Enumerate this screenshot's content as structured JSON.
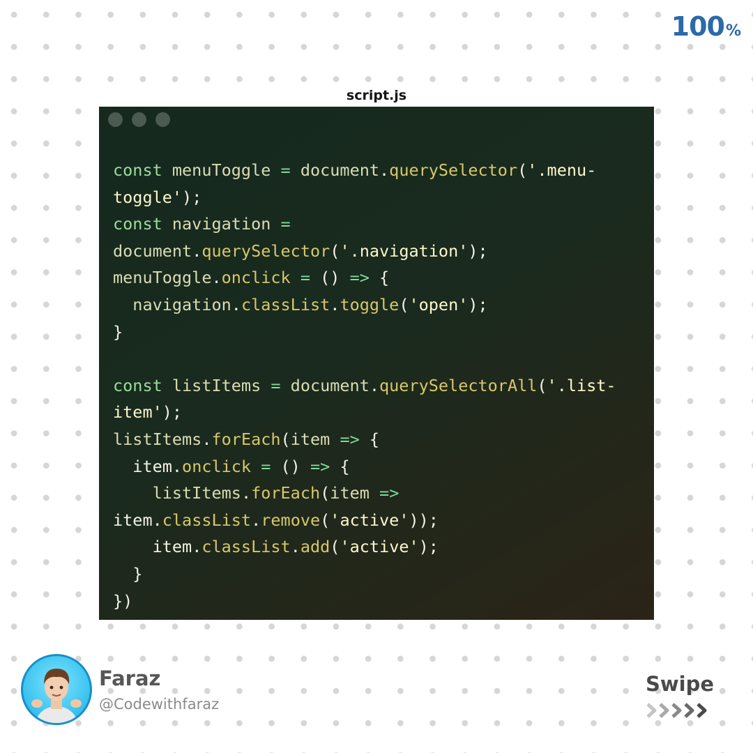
{
  "progress": {
    "value": "100",
    "unit": "%"
  },
  "editor": {
    "filename": "script.js",
    "code": [
      [
        [
          "kw",
          "const "
        ],
        [
          "id",
          "menuToggle "
        ],
        [
          "op",
          "= "
        ],
        [
          "id",
          "document"
        ],
        [
          "pn",
          "."
        ],
        [
          "fn",
          "querySelector"
        ],
        [
          "pn",
          "("
        ],
        [
          "str",
          "'.menu-"
        ]
      ],
      [
        [
          "str",
          "toggle'"
        ],
        [
          "pn",
          ");"
        ]
      ],
      [
        [
          "kw",
          "const "
        ],
        [
          "id",
          "navigation "
        ],
        [
          "op",
          "="
        ]
      ],
      [
        [
          "id",
          "document"
        ],
        [
          "pn",
          "."
        ],
        [
          "fn",
          "querySelector"
        ],
        [
          "pn",
          "("
        ],
        [
          "str",
          "'.navigation'"
        ],
        [
          "pn",
          ");"
        ]
      ],
      [
        [
          "id",
          "menuToggle"
        ],
        [
          "pn",
          "."
        ],
        [
          "fn",
          "onclick "
        ],
        [
          "op",
          "= "
        ],
        [
          "pn",
          "() "
        ],
        [
          "op",
          "=> "
        ],
        [
          "pn",
          "{"
        ]
      ],
      [
        [
          "pn",
          "  "
        ],
        [
          "id",
          "navigation"
        ],
        [
          "pn",
          "."
        ],
        [
          "fn",
          "classList"
        ],
        [
          "pn",
          "."
        ],
        [
          "fn",
          "toggle"
        ],
        [
          "pn",
          "("
        ],
        [
          "str",
          "'open'"
        ],
        [
          "pn",
          ");"
        ]
      ],
      [
        [
          "pn",
          "}"
        ]
      ],
      [],
      [
        [
          "kw",
          "const "
        ],
        [
          "id",
          "listItems "
        ],
        [
          "op",
          "= "
        ],
        [
          "id",
          "document"
        ],
        [
          "pn",
          "."
        ],
        [
          "fn",
          "querySelectorAll"
        ],
        [
          "pn",
          "("
        ],
        [
          "str",
          "'.list-"
        ]
      ],
      [
        [
          "str",
          "item'"
        ],
        [
          "pn",
          ");"
        ]
      ],
      [
        [
          "id",
          "listItems"
        ],
        [
          "pn",
          "."
        ],
        [
          "fn",
          "forEach"
        ],
        [
          "pn",
          "("
        ],
        [
          "id",
          "item "
        ],
        [
          "op",
          "=> "
        ],
        [
          "pn",
          "{"
        ]
      ],
      [
        [
          "pn",
          "  "
        ],
        [
          "pn",
          "item"
        ],
        [
          "pn",
          "."
        ],
        [
          "fn",
          "onclick "
        ],
        [
          "op",
          "= "
        ],
        [
          "pn",
          "() "
        ],
        [
          "op",
          "=> "
        ],
        [
          "pn",
          "{"
        ]
      ],
      [
        [
          "pn",
          "    "
        ],
        [
          "id",
          "listItems"
        ],
        [
          "pn",
          "."
        ],
        [
          "fn",
          "forEach"
        ],
        [
          "pn",
          "("
        ],
        [
          "id",
          "item "
        ],
        [
          "op",
          "=>"
        ]
      ],
      [
        [
          "pn",
          "item"
        ],
        [
          "pn",
          "."
        ],
        [
          "fn",
          "classList"
        ],
        [
          "pn",
          "."
        ],
        [
          "fn",
          "remove"
        ],
        [
          "pn",
          "("
        ],
        [
          "str",
          "'active'"
        ],
        [
          "pn",
          "));"
        ]
      ],
      [
        [
          "pn",
          "    "
        ],
        [
          "pn",
          "item"
        ],
        [
          "pn",
          "."
        ],
        [
          "fn",
          "classList"
        ],
        [
          "pn",
          "."
        ],
        [
          "fn",
          "add"
        ],
        [
          "pn",
          "("
        ],
        [
          "str",
          "'active'"
        ],
        [
          "pn",
          ");"
        ]
      ],
      [
        [
          "pn",
          "  }"
        ]
      ],
      [
        [
          "pn",
          "})"
        ]
      ]
    ]
  },
  "author": {
    "name": "Faraz",
    "handle": "@Codewithfaraz"
  },
  "cta": {
    "label": "Swipe"
  },
  "colors": {
    "accent": "#2b6aa8",
    "code_bg": "#1a2a1e",
    "keyword": "#9bdd9b",
    "function": "#d7c86a",
    "string": "#fff7cc"
  }
}
